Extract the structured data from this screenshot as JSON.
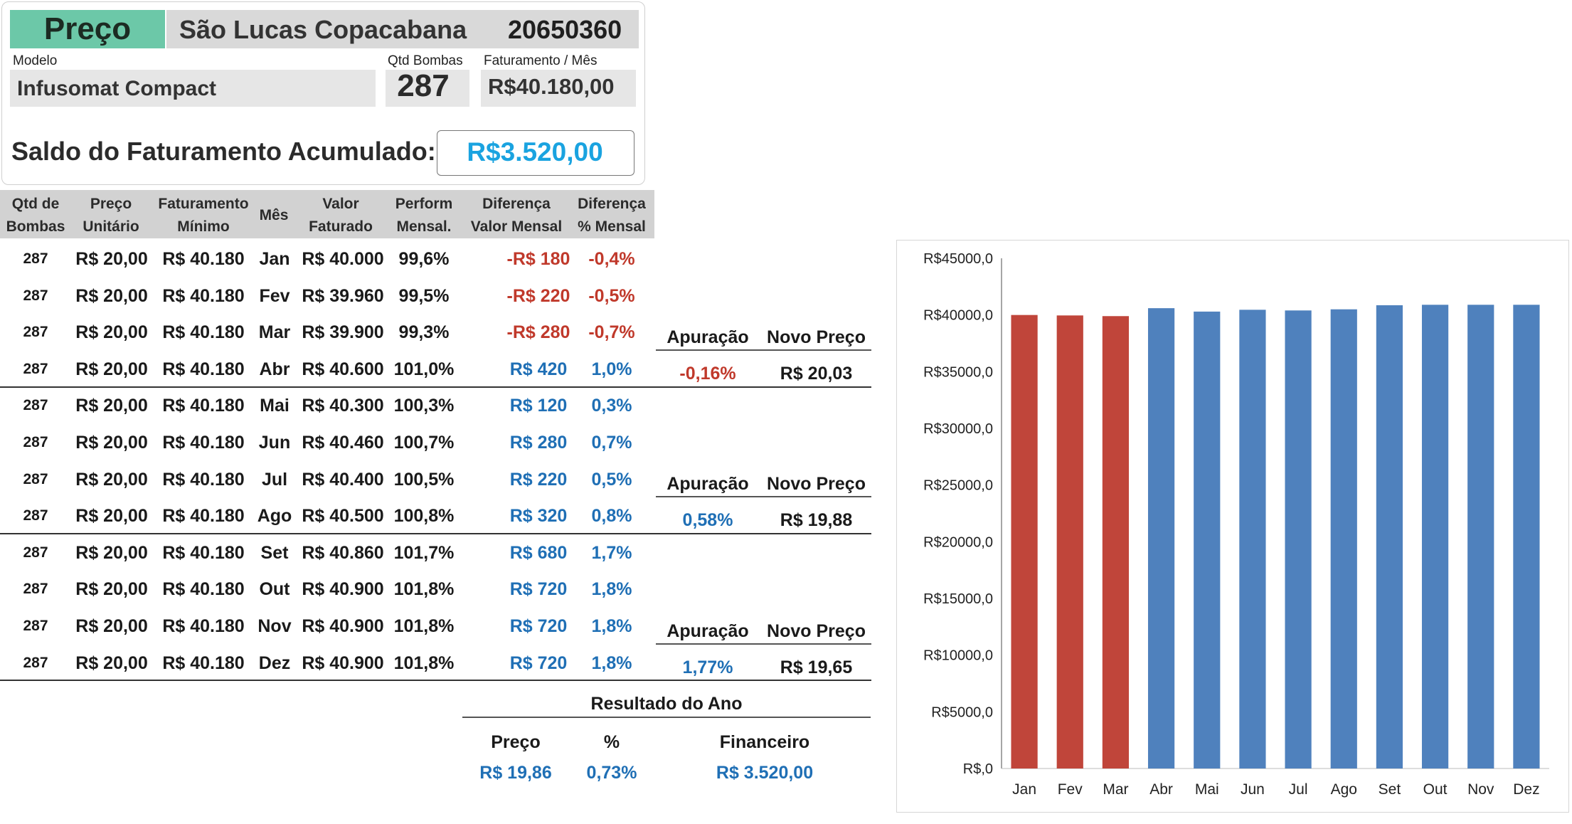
{
  "header": {
    "title": "Preço",
    "client_name": "São Lucas Copacabana",
    "client_id": "20650360",
    "modelo_label": "Modelo",
    "modelo_value": "Infusomat Compact",
    "qtd_label": "Qtd Bombas",
    "qtd_value": "287",
    "fat_label": "Faturamento / Mês",
    "fat_value": "R$40.180,00",
    "saldo_label": "Saldo do Faturamento Acumulado:",
    "saldo_value": "R$3.520,00"
  },
  "table": {
    "headers": [
      [
        "Qtd de",
        "Bombas"
      ],
      [
        "Preço",
        "Unitário"
      ],
      [
        "Faturamento",
        "Mínimo"
      ],
      [
        "Mês",
        ""
      ],
      [
        "Valor",
        "Faturado"
      ],
      [
        "Perform",
        "Mensal."
      ],
      [
        "Diferença",
        "Valor Mensal"
      ],
      [
        "Diferença",
        "% Mensal"
      ]
    ],
    "rows": [
      {
        "qtd": "287",
        "preco": "R$ 20,00",
        "fatmin": "R$ 40.180",
        "mes": "Jan",
        "valor": "R$ 40.000",
        "perf": "99,6%",
        "dif": "-R$ 180",
        "difpct": "-0,4%",
        "neg": true
      },
      {
        "qtd": "287",
        "preco": "R$ 20,00",
        "fatmin": "R$ 40.180",
        "mes": "Fev",
        "valor": "R$ 39.960",
        "perf": "99,5%",
        "dif": "-R$ 220",
        "difpct": "-0,5%",
        "neg": true
      },
      {
        "qtd": "287",
        "preco": "R$ 20,00",
        "fatmin": "R$ 40.180",
        "mes": "Mar",
        "valor": "R$ 39.900",
        "perf": "99,3%",
        "dif": "-R$ 280",
        "difpct": "-0,7%",
        "neg": true
      },
      {
        "qtd": "287",
        "preco": "R$ 20,00",
        "fatmin": "R$ 40.180",
        "mes": "Abr",
        "valor": "R$ 40.600",
        "perf": "101,0%",
        "dif": "R$ 420",
        "difpct": "1,0%",
        "neg": false
      },
      {
        "qtd": "287",
        "preco": "R$ 20,00",
        "fatmin": "R$ 40.180",
        "mes": "Mai",
        "valor": "R$ 40.300",
        "perf": "100,3%",
        "dif": "R$ 120",
        "difpct": "0,3%",
        "neg": false
      },
      {
        "qtd": "287",
        "preco": "R$ 20,00",
        "fatmin": "R$ 40.180",
        "mes": "Jun",
        "valor": "R$ 40.460",
        "perf": "100,7%",
        "dif": "R$ 280",
        "difpct": "0,7%",
        "neg": false
      },
      {
        "qtd": "287",
        "preco": "R$ 20,00",
        "fatmin": "R$ 40.180",
        "mes": "Jul",
        "valor": "R$ 40.400",
        "perf": "100,5%",
        "dif": "R$ 220",
        "difpct": "0,5%",
        "neg": false
      },
      {
        "qtd": "287",
        "preco": "R$ 20,00",
        "fatmin": "R$ 40.180",
        "mes": "Ago",
        "valor": "R$ 40.500",
        "perf": "100,8%",
        "dif": "R$ 320",
        "difpct": "0,8%",
        "neg": false
      },
      {
        "qtd": "287",
        "preco": "R$ 20,00",
        "fatmin": "R$ 40.180",
        "mes": "Set",
        "valor": "R$ 40.860",
        "perf": "101,7%",
        "dif": "R$ 680",
        "difpct": "1,7%",
        "neg": false
      },
      {
        "qtd": "287",
        "preco": "R$ 20,00",
        "fatmin": "R$ 40.180",
        "mes": "Out",
        "valor": "R$ 40.900",
        "perf": "101,8%",
        "dif": "R$ 720",
        "difpct": "1,8%",
        "neg": false
      },
      {
        "qtd": "287",
        "preco": "R$ 20,00",
        "fatmin": "R$ 40.180",
        "mes": "Nov",
        "valor": "R$ 40.900",
        "perf": "101,8%",
        "dif": "R$ 720",
        "difpct": "1,8%",
        "neg": false
      },
      {
        "qtd": "287",
        "preco": "R$ 20,00",
        "fatmin": "R$ 40.180",
        "mes": "Dez",
        "valor": "R$ 40.900",
        "perf": "101,8%",
        "dif": "R$ 720",
        "difpct": "1,8%",
        "neg": false
      }
    ]
  },
  "apuracao": [
    {
      "label": "Apuração",
      "preco_label": "Novo Preço",
      "value": "-0,16%",
      "price": "R$ 20,03",
      "neg": true
    },
    {
      "label": "Apuração",
      "preco_label": "Novo Preço",
      "value": "0,58%",
      "price": "R$ 19,88",
      "neg": false
    },
    {
      "label": "Apuração",
      "preco_label": "Novo Preço",
      "value": "1,77%",
      "price": "R$ 19,65",
      "neg": false
    }
  ],
  "resultado": {
    "title": "Resultado do Ano",
    "preco_label": "Preço",
    "pct_label": "%",
    "fin_label": "Financeiro",
    "preco_value": "R$ 19,86",
    "pct_value": "0,73%",
    "fin_value": "R$ 3.520,00"
  },
  "colors": {
    "header_green": "#6cc8a8",
    "negative_red": "#c0392b",
    "positive_blue": "#1f6fb5",
    "saldo_cyan": "#1aa3e0",
    "bar_red": "#c0453a",
    "bar_blue": "#4f81bd"
  },
  "chart_data": {
    "type": "bar",
    "categories": [
      "Jan",
      "Fev",
      "Mar",
      "Abr",
      "Mai",
      "Jun",
      "Jul",
      "Ago",
      "Set",
      "Out",
      "Nov",
      "Dez"
    ],
    "values": [
      40000,
      39960,
      39900,
      40600,
      40300,
      40460,
      40400,
      40500,
      40860,
      40900,
      40900,
      40900
    ],
    "bar_colors": [
      "#c0453a",
      "#c0453a",
      "#c0453a",
      "#4f81bd",
      "#4f81bd",
      "#4f81bd",
      "#4f81bd",
      "#4f81bd",
      "#4f81bd",
      "#4f81bd",
      "#4f81bd",
      "#4f81bd"
    ],
    "ylim": [
      0,
      45000
    ],
    "yticks": [
      "R$,0",
      "R$5000,0",
      "R$10000,0",
      "R$15000,0",
      "R$20000,0",
      "R$25000,0",
      "R$30000,0",
      "R$35000,0",
      "R$40000,0",
      "R$45000,0"
    ],
    "title": "",
    "xlabel": "",
    "ylabel": "",
    "grid": false
  }
}
